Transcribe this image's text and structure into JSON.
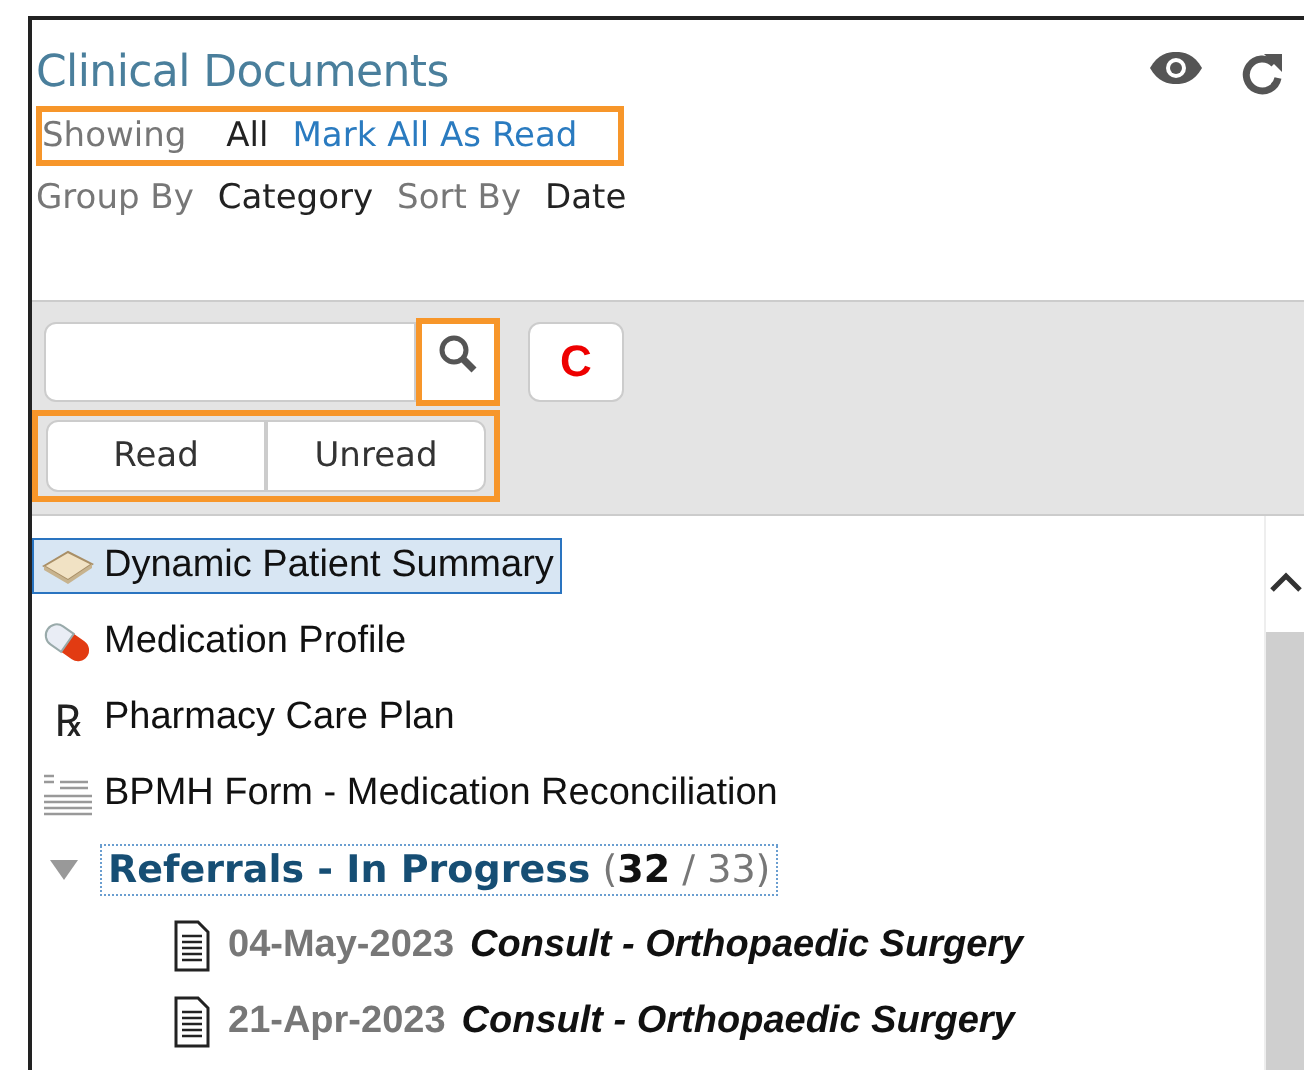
{
  "panel": {
    "title": "Clinical Documents",
    "header_icons": [
      {
        "kind": "eye"
      },
      {
        "kind": "refresh"
      }
    ],
    "showing": {
      "label": "Showing",
      "value": "All",
      "action": "Mark All As Read",
      "highlighted": true
    },
    "grouping": [
      {
        "label": "Group By",
        "value": "Category"
      },
      {
        "label": "Sort By",
        "value": "Date"
      }
    ]
  },
  "toolbar": {
    "search": {
      "button_highlighted": true
    },
    "clear_button": "C",
    "filters_highlighted": true,
    "filters": [
      {
        "label": "Read"
      },
      {
        "label": "Unread"
      }
    ]
  },
  "tree": {
    "items": [
      {
        "kind": "summary",
        "label": "Dynamic Patient Summary",
        "selected": true
      },
      {
        "kind": "medication",
        "label": "Medication Profile",
        "selected": false
      },
      {
        "kind": "rx",
        "glyph": "℞",
        "label": "Pharmacy Care Plan",
        "selected": false
      },
      {
        "kind": "form",
        "label": "BPMH Form - Medication Reconciliation",
        "selected": false
      }
    ],
    "group": {
      "label": "Referrals - In Progress",
      "open": "(",
      "unread": "32",
      "separator": "/",
      "total": "33)",
      "expanded": true,
      "children": [
        {
          "date": "04-May-2023",
          "title": "Consult - Orthopaedic Surgery"
        },
        {
          "date": "21-Apr-2023",
          "title": "Consult - Orthopaedic Surgery"
        }
      ]
    }
  }
}
